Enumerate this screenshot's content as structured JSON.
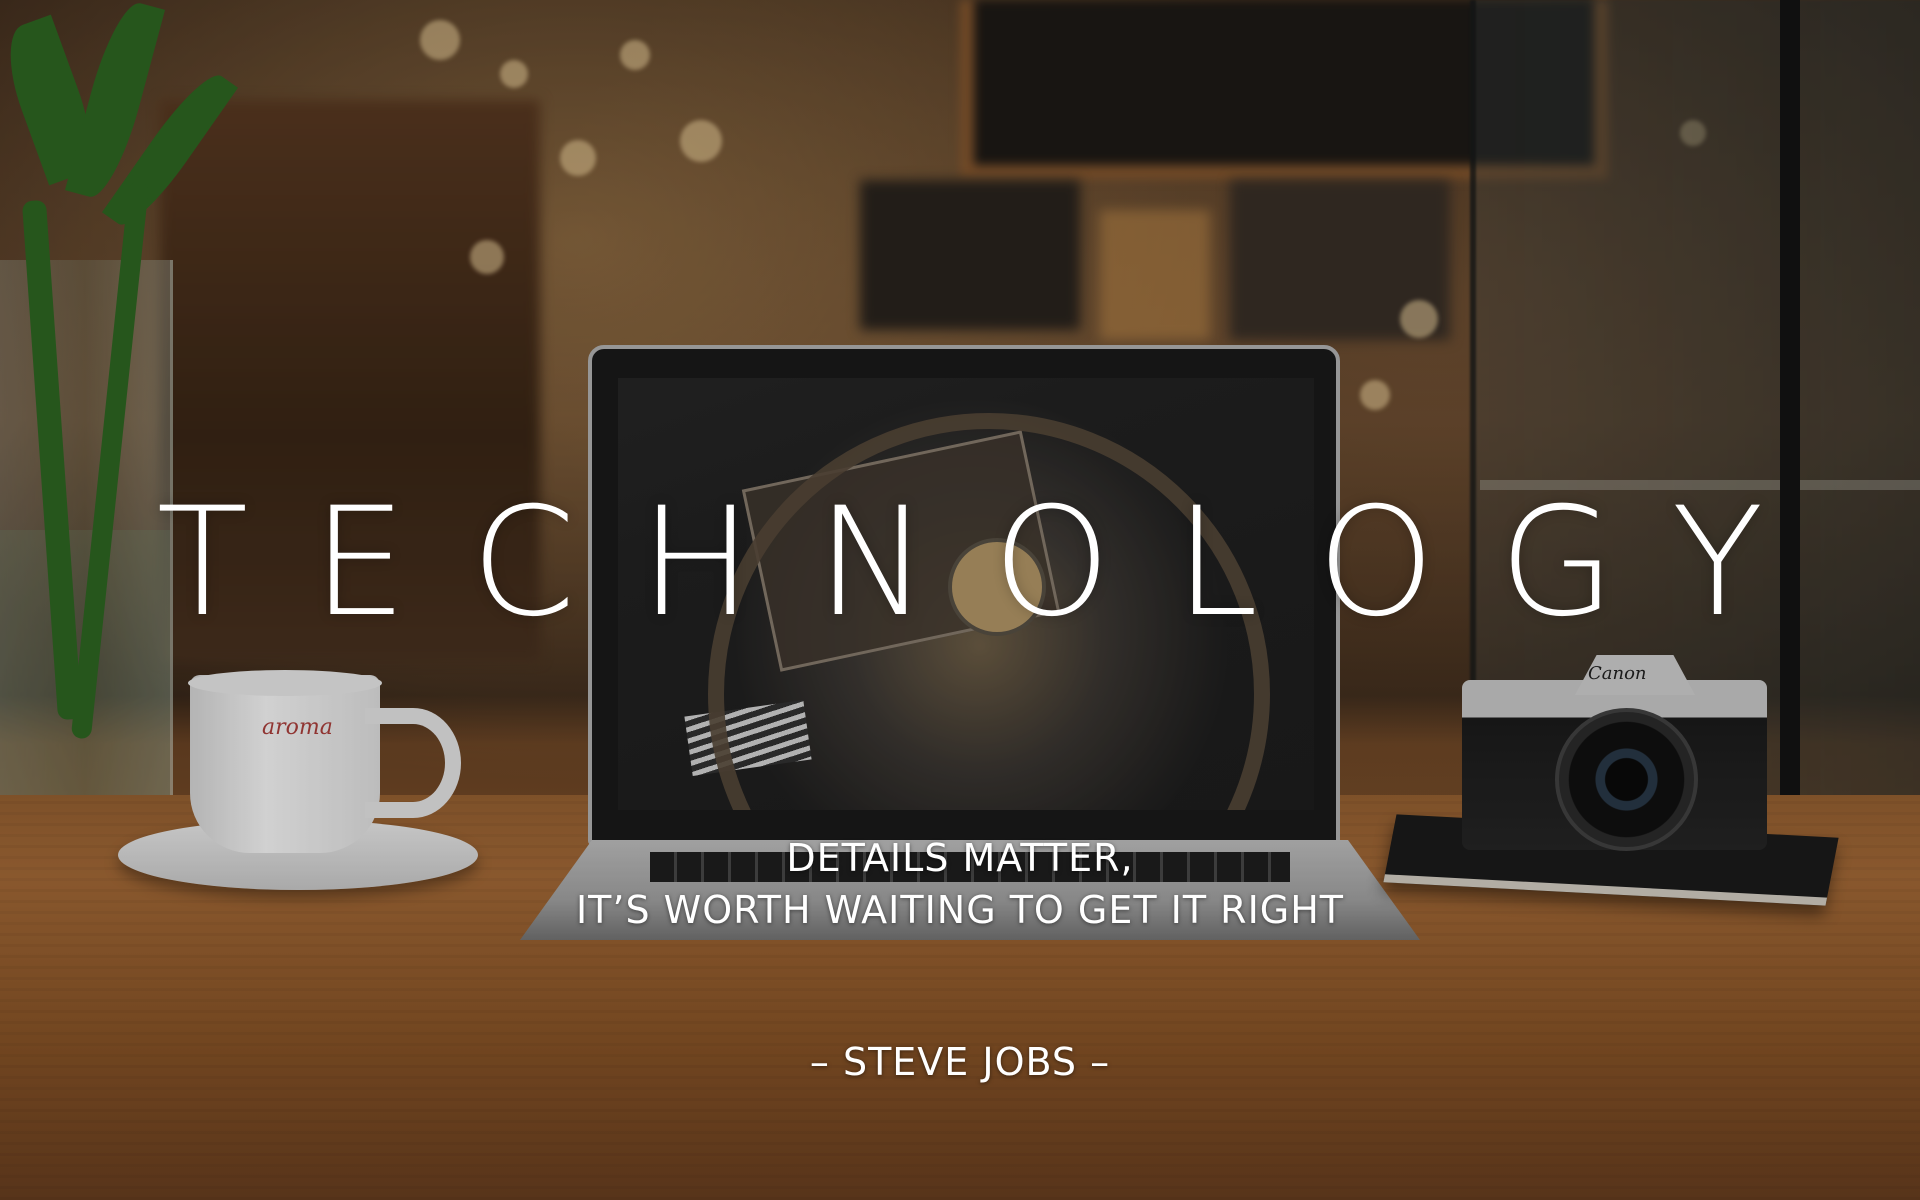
{
  "headline": "TECHNOLOGY",
  "quote": {
    "line1": "DETAILS MATTER,",
    "line2": "IT’S WORTH WAITING TO GET IT RIGHT"
  },
  "author": "– STEVE JOBS –",
  "cup_logo": "aroma",
  "camera_brand": "Canon",
  "colors": {
    "text": "#ffffff",
    "table_wood": "#a86c38",
    "plant_green": "#2f6a23"
  }
}
